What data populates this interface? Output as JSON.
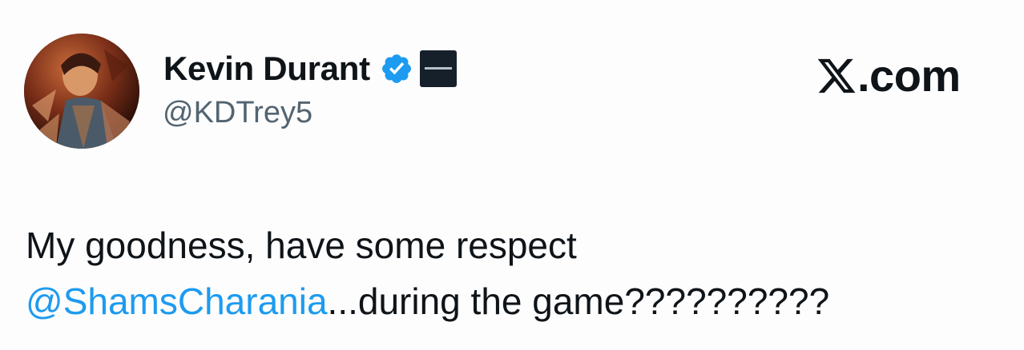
{
  "author": {
    "display_name": "Kevin Durant",
    "handle": "@KDTrey5",
    "verified": true
  },
  "site": {
    "logo_text": ".com",
    "logo_icon": "x-logo-icon"
  },
  "tweet": {
    "line1": "My goodness, have some respect",
    "mention": "@ShamsCharania",
    "line2_rest": "...during the game??????????"
  },
  "colors": {
    "mention": "#1d9bf0",
    "verified": "#1d9bf0",
    "text": "#0f1419",
    "handle": "#536471"
  }
}
